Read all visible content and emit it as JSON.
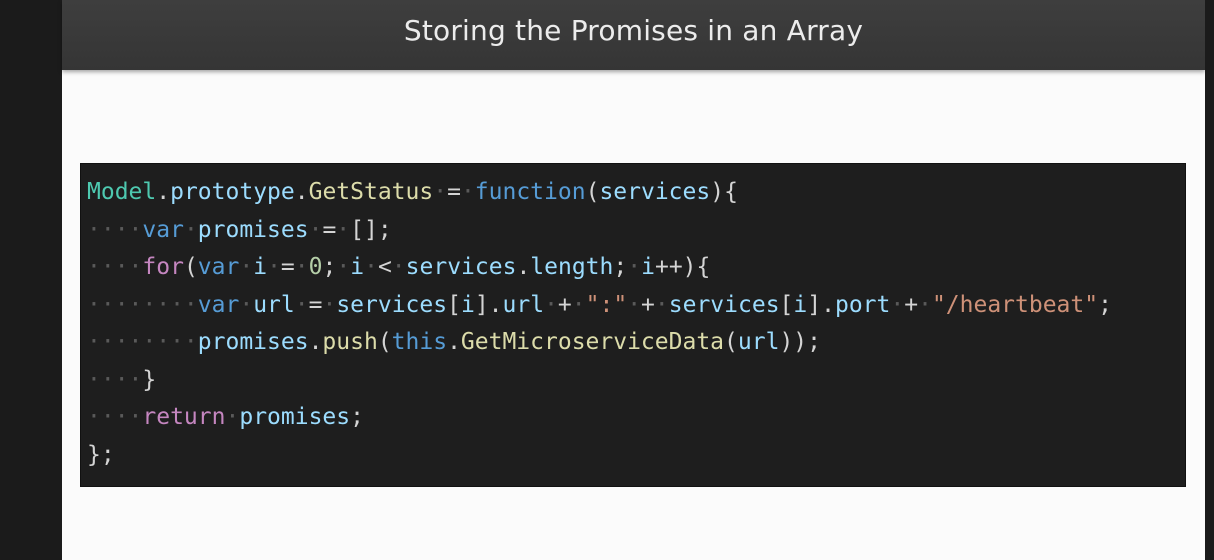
{
  "slide": {
    "title": "Storing the Promises in an Array"
  },
  "code": {
    "lines": [
      [
        {
          "t": "Model",
          "c": "type"
        },
        {
          "t": ".",
          "c": "punc"
        },
        {
          "t": "prototype",
          "c": "var"
        },
        {
          "t": ".",
          "c": "punc"
        },
        {
          "t": "GetStatus",
          "c": "fn"
        },
        {
          "t": "·",
          "c": "ws"
        },
        {
          "t": "=",
          "c": "punc"
        },
        {
          "t": "·",
          "c": "ws"
        },
        {
          "t": "function",
          "c": "kw"
        },
        {
          "t": "(",
          "c": "punc"
        },
        {
          "t": "services",
          "c": "var"
        },
        {
          "t": "){",
          "c": "punc"
        }
      ],
      [
        {
          "t": "····",
          "c": "ws"
        },
        {
          "t": "var",
          "c": "kw"
        },
        {
          "t": "·",
          "c": "ws"
        },
        {
          "t": "promises",
          "c": "var"
        },
        {
          "t": "·",
          "c": "ws"
        },
        {
          "t": "=",
          "c": "punc"
        },
        {
          "t": "·",
          "c": "ws"
        },
        {
          "t": "[];",
          "c": "punc"
        }
      ],
      [
        {
          "t": "····",
          "c": "ws"
        },
        {
          "t": "for",
          "c": "ctl"
        },
        {
          "t": "(",
          "c": "punc"
        },
        {
          "t": "var",
          "c": "kw"
        },
        {
          "t": "·",
          "c": "ws"
        },
        {
          "t": "i",
          "c": "var"
        },
        {
          "t": "·",
          "c": "ws"
        },
        {
          "t": "=",
          "c": "punc"
        },
        {
          "t": "·",
          "c": "ws"
        },
        {
          "t": "0",
          "c": "num"
        },
        {
          "t": ";",
          "c": "punc"
        },
        {
          "t": "·",
          "c": "ws"
        },
        {
          "t": "i",
          "c": "var"
        },
        {
          "t": "·",
          "c": "ws"
        },
        {
          "t": "<",
          "c": "punc"
        },
        {
          "t": "·",
          "c": "ws"
        },
        {
          "t": "services",
          "c": "var"
        },
        {
          "t": ".",
          "c": "punc"
        },
        {
          "t": "length",
          "c": "var"
        },
        {
          "t": ";",
          "c": "punc"
        },
        {
          "t": "·",
          "c": "ws"
        },
        {
          "t": "i",
          "c": "var"
        },
        {
          "t": "++){",
          "c": "punc"
        }
      ],
      [
        {
          "t": "········",
          "c": "ws"
        },
        {
          "t": "var",
          "c": "kw"
        },
        {
          "t": "·",
          "c": "ws"
        },
        {
          "t": "url",
          "c": "var"
        },
        {
          "t": "·",
          "c": "ws"
        },
        {
          "t": "=",
          "c": "punc"
        },
        {
          "t": "·",
          "c": "ws"
        },
        {
          "t": "services",
          "c": "var"
        },
        {
          "t": "[",
          "c": "punc"
        },
        {
          "t": "i",
          "c": "var"
        },
        {
          "t": "].",
          "c": "punc"
        },
        {
          "t": "url",
          "c": "var"
        },
        {
          "t": "·",
          "c": "ws"
        },
        {
          "t": "+",
          "c": "punc"
        },
        {
          "t": "·",
          "c": "ws"
        },
        {
          "t": "\":\"",
          "c": "str"
        },
        {
          "t": "·",
          "c": "ws"
        },
        {
          "t": "+",
          "c": "punc"
        },
        {
          "t": "·",
          "c": "ws"
        },
        {
          "t": "services",
          "c": "var"
        },
        {
          "t": "[",
          "c": "punc"
        },
        {
          "t": "i",
          "c": "var"
        },
        {
          "t": "].",
          "c": "punc"
        },
        {
          "t": "port",
          "c": "var"
        },
        {
          "t": "·",
          "c": "ws"
        },
        {
          "t": "+",
          "c": "punc"
        },
        {
          "t": "·",
          "c": "ws"
        },
        {
          "t": "\"/heartbeat\"",
          "c": "str"
        },
        {
          "t": ";",
          "c": "punc"
        }
      ],
      [
        {
          "t": "········",
          "c": "ws"
        },
        {
          "t": "promises",
          "c": "var"
        },
        {
          "t": ".",
          "c": "punc"
        },
        {
          "t": "push",
          "c": "fn"
        },
        {
          "t": "(",
          "c": "punc"
        },
        {
          "t": "this",
          "c": "kw"
        },
        {
          "t": ".",
          "c": "punc"
        },
        {
          "t": "GetMicroserviceData",
          "c": "fn"
        },
        {
          "t": "(",
          "c": "punc"
        },
        {
          "t": "url",
          "c": "var"
        },
        {
          "t": "));",
          "c": "punc"
        }
      ],
      [
        {
          "t": "····",
          "c": "ws"
        },
        {
          "t": "}",
          "c": "punc"
        }
      ],
      [
        {
          "t": "····",
          "c": "ws"
        },
        {
          "t": "return",
          "c": "ctl"
        },
        {
          "t": "·",
          "c": "ws"
        },
        {
          "t": "promises",
          "c": "var"
        },
        {
          "t": ";",
          "c": "punc"
        }
      ],
      [
        {
          "t": "};",
          "c": "punc"
        }
      ]
    ]
  }
}
